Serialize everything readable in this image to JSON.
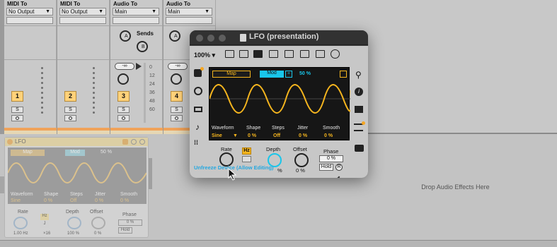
{
  "tracks": [
    {
      "routing_label": "MIDI To",
      "routing_value": "No Output",
      "number": "1",
      "solo": "S"
    },
    {
      "routing_label": "MIDI To",
      "routing_value": "No Output",
      "number": "2",
      "solo": "S"
    },
    {
      "routing_label": "Audio To",
      "routing_value": "Main",
      "number": "3",
      "solo": "S",
      "sends_label": "Sends",
      "send_a": "A",
      "send_b": "B",
      "vol": "-∞"
    },
    {
      "routing_label": "Audio To",
      "routing_value": "Main",
      "number": "4",
      "solo": "S",
      "send_a": "A",
      "vol": "-∞"
    }
  ],
  "meter_scale": [
    "0",
    "12",
    "24",
    "36",
    "48",
    "60"
  ],
  "drop_text": "Drop Audio Effects Here",
  "lfo_device": {
    "title": "LFO",
    "map": "Map",
    "mod": "Mod",
    "pct": "50 %",
    "labels": [
      "Waveform",
      "Shape",
      "Steps",
      "Jitter",
      "Smooth"
    ],
    "values": [
      "Sine",
      "0 %",
      "Off",
      "0 %",
      "0 %"
    ],
    "rate": "Rate",
    "hz": "Hz",
    "depth": "Depth",
    "offset": "Offset",
    "phase": "Phase",
    "rate_val": "1.00 Hz",
    "x16": "×16",
    "depth_val": "100 %",
    "offset_val": "0 %",
    "phase_val": "0 %",
    "hold": "Hold",
    "j": "J"
  },
  "popup": {
    "title": "LFO (presentation)",
    "zoom": "100%",
    "zoom_arrow": "▾",
    "map": "Map",
    "mod": "Mod",
    "plus": "+",
    "pct": "50 %",
    "labels": [
      "Waveform",
      "Shape",
      "Steps",
      "Jitter",
      "Smooth"
    ],
    "values": [
      "Sine",
      "0 %",
      "Off",
      "0 %",
      "0 %"
    ],
    "waveform_arrow": "▼",
    "rate": "Rate",
    "hz": "Hz",
    "depth": "Depth",
    "offset": "Offset",
    "phase": "Phase",
    "phase_val": "0 %",
    "depth_val": "%",
    "offset_val": "0 %",
    "hold": "Hold",
    "r": "R",
    "unfreeze": "Unfreeze Device (Allow Editing)"
  },
  "colors": {
    "accent_orange": "#f5b51e",
    "accent_cyan": "#19c6ea",
    "link_blue": "#25a8e0"
  }
}
